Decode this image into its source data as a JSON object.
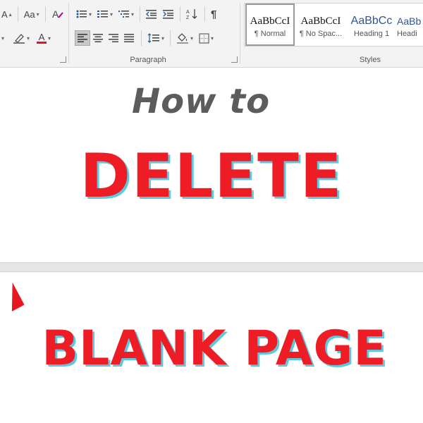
{
  "ribbon": {
    "font_group": {
      "grow_font": "A",
      "change_case": "Aa",
      "clear_format_icon": "clear-formatting-icon",
      "font_color_letter": "A",
      "font_color_hex": "#e81123"
    },
    "paragraph_group": {
      "label": "Paragraph",
      "pilcrow": "¶"
    },
    "styles_group": {
      "label": "Styles",
      "items": [
        {
          "preview": "AaBbCcI",
          "name": "¶ Normal"
        },
        {
          "preview": "AaBbCcI",
          "name": "¶ No Spac..."
        },
        {
          "preview": "AaBbCc",
          "name": "Heading 1"
        },
        {
          "preview": "AaBb",
          "name": "Headi"
        }
      ]
    }
  },
  "document": {
    "line1": "How to",
    "line2": "DELETE",
    "line3": "BLANK PAGE"
  },
  "colors": {
    "headline_red": "#ee1c24",
    "headline_shadow": "#5ec8e0",
    "gray_text": "#5c5c5c",
    "heading_blue": "#2f5496"
  }
}
